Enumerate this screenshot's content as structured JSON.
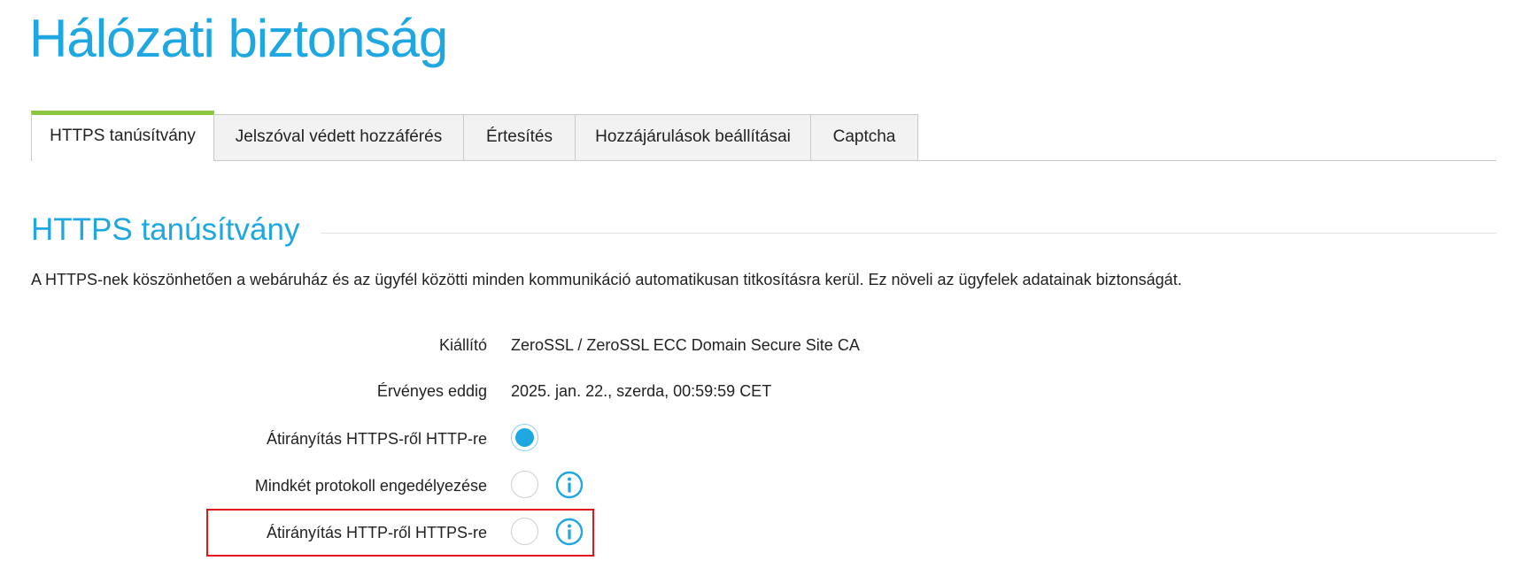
{
  "page": {
    "title": "Hálózati biztonság"
  },
  "tabs": [
    {
      "label": "HTTPS tanúsítvány",
      "active": true
    },
    {
      "label": "Jelszóval védett hozzáférés",
      "active": false
    },
    {
      "label": "Értesítés",
      "active": false
    },
    {
      "label": "Hozzájárulások beállításai",
      "active": false
    },
    {
      "label": "Captcha",
      "active": false
    }
  ],
  "section": {
    "title": "HTTPS tanúsítvány",
    "description": "A HTTPS-nek köszönhetően a webáruház és az ügyfél közötti minden kommunikáció automatikusan titkosításra kerül. Ez növeli az ügyfelek adatainak biztonságát."
  },
  "details": {
    "issuer_label": "Kiállító",
    "issuer_value": "ZeroSSL / ZeroSSL ECC Domain Secure Site CA",
    "valid_until_label": "Érvényes eddig",
    "valid_until_value": "2025. jan. 22., szerda, 00:59:59 CET"
  },
  "options": [
    {
      "label": "Átirányítás HTTPS-ről HTTP-re",
      "selected": true,
      "has_info": false
    },
    {
      "label": "Mindkét protokoll engedélyezése",
      "selected": false,
      "has_info": true
    },
    {
      "label": "Átirányítás HTTP-ről HTTPS-re",
      "selected": false,
      "has_info": true,
      "highlighted": true
    }
  ],
  "icons": {
    "info": "info-circle-icon"
  },
  "colors": {
    "accent": "#1ea7e1",
    "active_tab_bar": "#8cc63f",
    "highlight": "#e3141a"
  }
}
